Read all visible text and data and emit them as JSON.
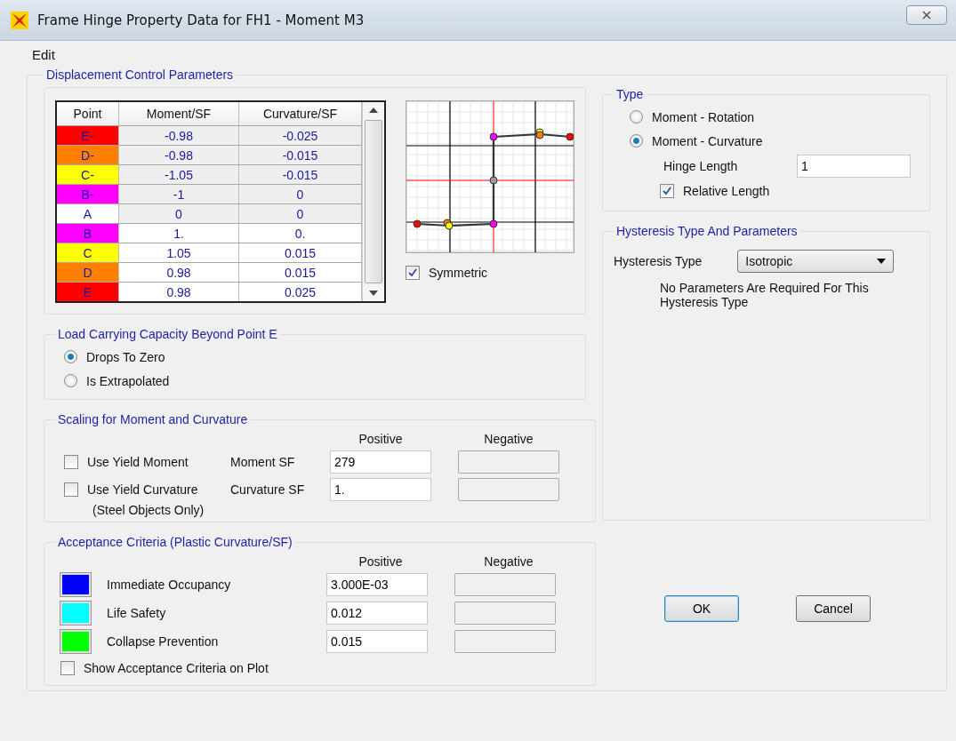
{
  "window": {
    "title": "Frame Hinge Property Data for FH1 - Moment M3"
  },
  "menu": [
    "Edit"
  ],
  "displacement_control": {
    "title": "Displacement Control Parameters",
    "table": {
      "columns": [
        "Point",
        "Moment/SF",
        "Curvature/SF"
      ],
      "rows": [
        {
          "point": "E-",
          "color": "#ff0000",
          "moment": "-0.98",
          "curvature": "-0.025",
          "disabled": true
        },
        {
          "point": "D-",
          "color": "#ff8000",
          "moment": "-0.98",
          "curvature": "-0.015",
          "disabled": true
        },
        {
          "point": "C-",
          "color": "#ffff00",
          "moment": "-1.05",
          "curvature": "-0.015",
          "disabled": true
        },
        {
          "point": "B-",
          "color": "#ff00ff",
          "moment": "-1",
          "curvature": "0",
          "disabled": true
        },
        {
          "point": "A",
          "color": "#ffffff",
          "moment": "0",
          "curvature": "0",
          "disabled": true
        },
        {
          "point": "B",
          "color": "#ff00ff",
          "moment": "1.",
          "curvature": "0.",
          "disabled": false
        },
        {
          "point": "C",
          "color": "#ffff00",
          "moment": "1.05",
          "curvature": "0.015",
          "disabled": false
        },
        {
          "point": "D",
          "color": "#ff8000",
          "moment": "0.98",
          "curvature": "0.015",
          "disabled": false
        },
        {
          "point": "E",
          "color": "#ff0000",
          "moment": "0.98",
          "curvature": "0.025",
          "disabled": false
        }
      ]
    },
    "symmetric": {
      "label": "Symmetric",
      "checked": true
    }
  },
  "load_capacity": {
    "title": "Load Carrying Capacity Beyond Point E",
    "options": [
      {
        "label": "Drops To Zero",
        "selected": true
      },
      {
        "label": "Is Extrapolated",
        "selected": false
      }
    ]
  },
  "scaling": {
    "title": "Scaling for Moment and Curvature",
    "columns": [
      "Positive",
      "Negative"
    ],
    "rows": [
      {
        "check_label": "Use Yield Moment",
        "checked": false,
        "label": "Moment SF",
        "positive": "279"
      },
      {
        "check_label": "Use Yield Curvature",
        "checked": false,
        "label": "Curvature SF",
        "positive": "1."
      }
    ],
    "note": "(Steel Objects Only)"
  },
  "acceptance": {
    "title": "Acceptance Criteria (Plastic Curvature/SF)",
    "columns": [
      "Positive",
      "Negative"
    ],
    "rows": [
      {
        "color": "#0000ff",
        "label": "Immediate Occupancy",
        "positive": "3.000E-03"
      },
      {
        "color": "#00ffff",
        "label": "Life Safety",
        "positive": "0.012"
      },
      {
        "color": "#00ff00",
        "label": "Collapse Prevention",
        "positive": "0.015"
      }
    ],
    "show_on_plot": {
      "label": "Show Acceptance Criteria on Plot",
      "checked": false
    }
  },
  "type": {
    "title": "Type",
    "options": [
      {
        "label": "Moment - Rotation",
        "selected": false
      },
      {
        "label": "Moment - Curvature",
        "selected": true
      }
    ],
    "hinge_length": {
      "label": "Hinge Length",
      "value": "1"
    },
    "relative_length": {
      "label": "Relative Length",
      "checked": true
    }
  },
  "hysteresis": {
    "title": "Hysteresis Type And Parameters",
    "label": "Hysteresis Type",
    "value": "Isotropic",
    "note": "No Parameters Are Required For This Hysteresis Type"
  },
  "buttons": [
    "OK",
    "Cancel"
  ]
}
